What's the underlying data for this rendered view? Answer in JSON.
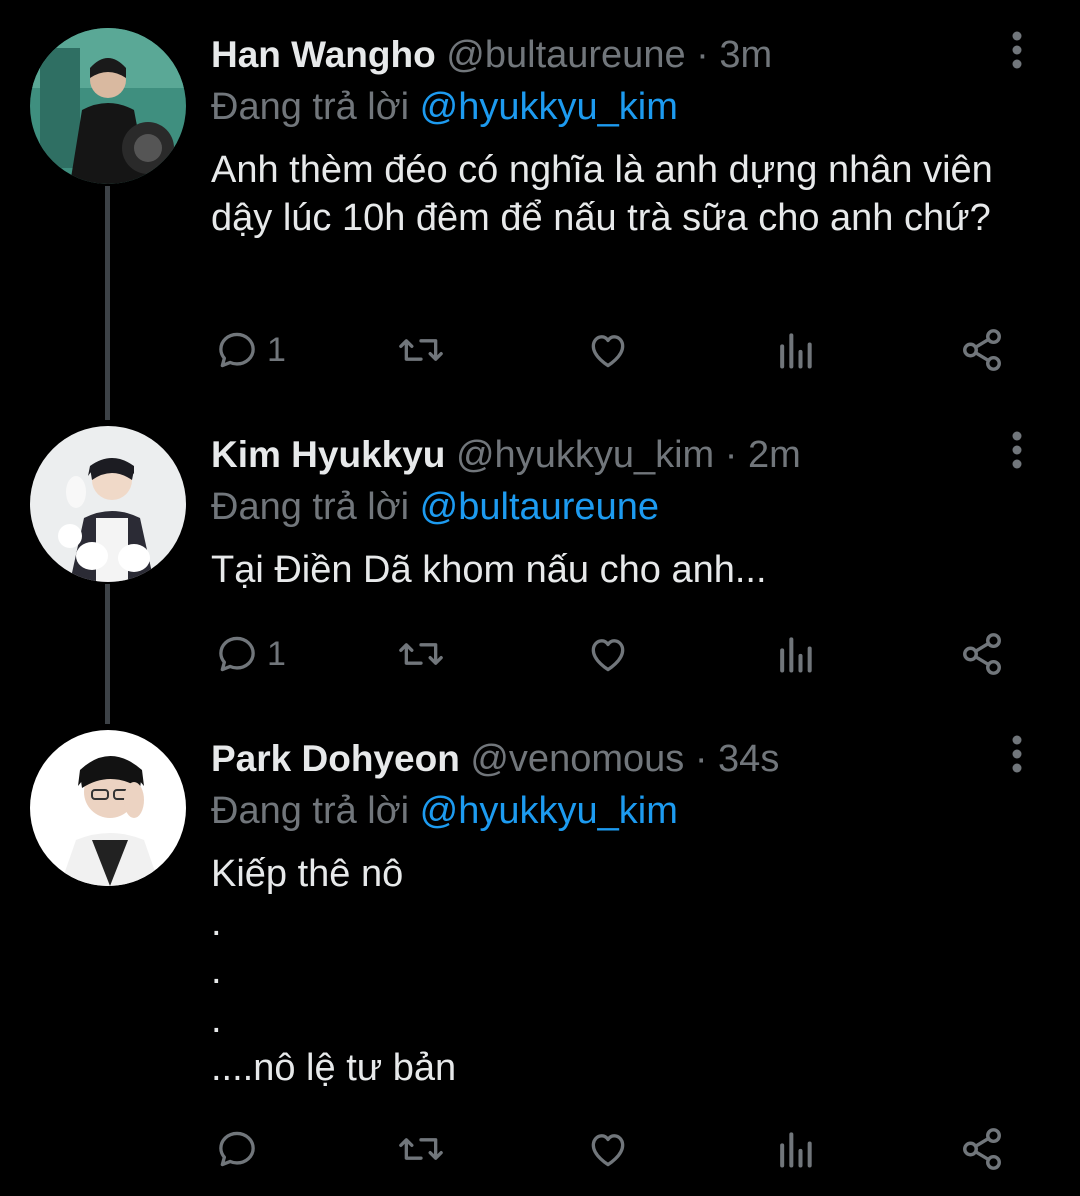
{
  "theme": {
    "background": "#000000",
    "text": "#e7e9ea",
    "muted": "#71767b",
    "accent": "#1d9bf0",
    "thread_line": "#3d4247"
  },
  "reply_prefix": "Đang trả lời",
  "tweets": [
    {
      "name": "Han Wangho",
      "handle": "@bultaureune",
      "separator": "·",
      "time": "3m",
      "replying_to": "@hyukkyu_kim",
      "text": "Anh thèm đéo có nghĩa là anh dựng nhân viên dậy lúc 10h đêm để nấu trà sữa cho anh chứ?",
      "reply_count": "1",
      "icons": [
        "reply-icon",
        "retweet-icon",
        "like-icon",
        "analytics-icon",
        "share-icon",
        "more-icon"
      ]
    },
    {
      "name": "Kim Hyukkyu",
      "handle": "@hyukkyu_kim",
      "separator": "·",
      "time": "2m",
      "replying_to": "@bultaureune",
      "text": "Tại Điền Dã khom nấu cho anh...",
      "reply_count": "1",
      "icons": [
        "reply-icon",
        "retweet-icon",
        "like-icon",
        "analytics-icon",
        "share-icon",
        "more-icon"
      ]
    },
    {
      "name": "Park Dohyeon",
      "handle": "@venomous",
      "separator": "·",
      "time": "34s",
      "replying_to": "@hyukkyu_kim",
      "text": "Kiếp thê nô\n.\n.\n.\n....nô lệ tư bản",
      "reply_count": "",
      "icons": [
        "reply-icon",
        "retweet-icon",
        "like-icon",
        "analytics-icon",
        "share-icon",
        "more-icon"
      ]
    }
  ]
}
